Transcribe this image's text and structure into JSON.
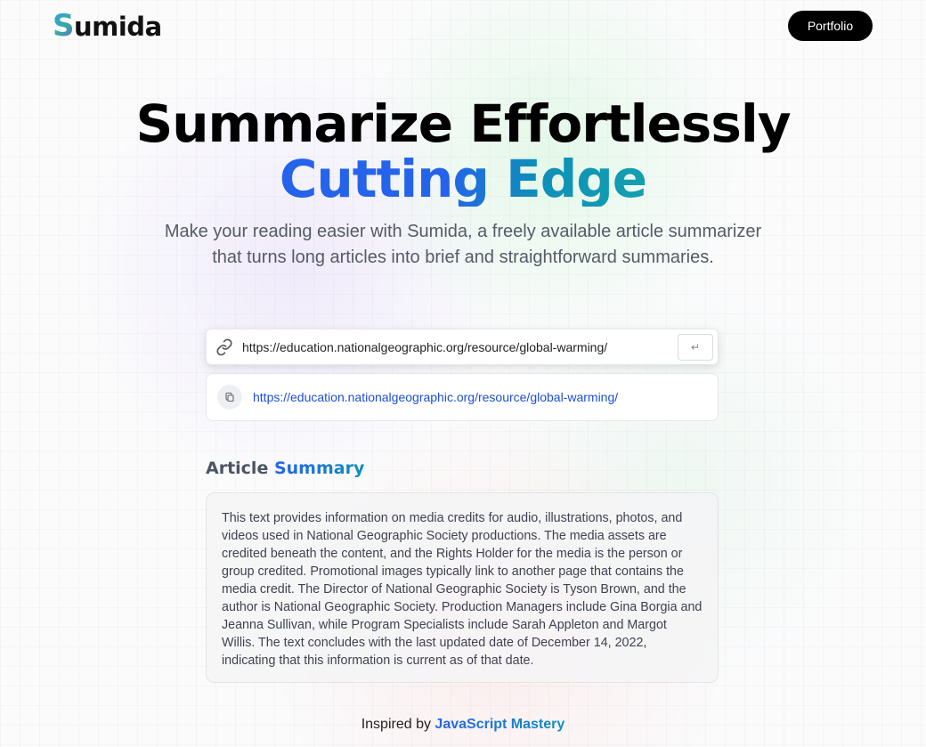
{
  "nav": {
    "logo_initial": "S",
    "logo_rest": "umida",
    "portfolio_label": "Portfolio"
  },
  "hero": {
    "title_line1": "Summarize Effortlessly",
    "title_line2": "Cutting Edge",
    "subtitle": "Make your reading easier with Sumida, a freely available article summarizer that turns long articles into brief and straightforward summaries."
  },
  "search": {
    "url_value": "https://education.nationalgeographic.org/resource/global-warming/",
    "submit_glyph": "↵",
    "link_icon": "link-icon"
  },
  "history": {
    "items": [
      {
        "url": "https://education.nationalgeographic.org/resource/global-warming/",
        "icon": "copy-icon"
      }
    ]
  },
  "summary": {
    "heading_plain": "Article",
    "heading_accent": "Summary",
    "text": "This text provides information on media credits for audio, illustrations, photos, and videos used in National Geographic Society productions. The media assets are credited beneath the content, and the Rights Holder for the media is the person or group credited. Promotional images typically link to another page that contains the media credit. The Director of National Geographic Society is Tyson Brown, and the author is National Geographic Society. Production Managers include Gina Borgia and Jeanna Sullivan, while Program Specialists include Sarah Appleton and Margot Willis. The text concludes with the last updated date of December 14, 2022, indicating that this information is current as of that date."
  },
  "footer": {
    "prefix": "Inspired by",
    "credit": "JavaScript Mastery"
  },
  "colors": {
    "accent_blue": "#2563eb",
    "accent_teal": "#0e8fb8",
    "button_dark": "#000000"
  }
}
